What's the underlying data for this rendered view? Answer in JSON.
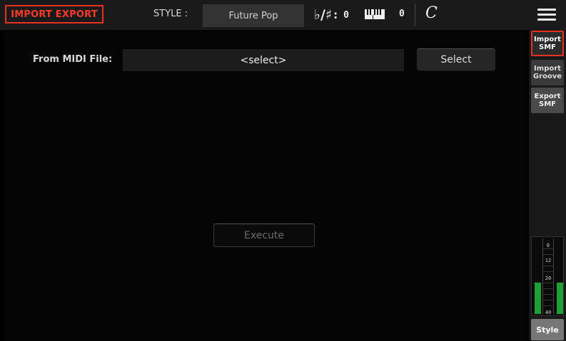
{
  "header": {
    "page_title": "IMPORT EXPORT",
    "style_label": "STYLE :",
    "style_name": "Future Pop",
    "transpose_icon": "flat-sharp-icon",
    "transpose_value": "0",
    "keyboard_icon": "keyboard-icon",
    "octave_value": "0",
    "tempo_icon": "common-time-icon",
    "tempo_symbol": "C",
    "menu_icon": "hamburger-menu-icon"
  },
  "main": {
    "from_midi_label": "From MIDI File:",
    "midi_field_value": "<select>",
    "select_button": "Select",
    "execute_button": "Execute"
  },
  "side_tabs": [
    {
      "line1": "Import",
      "line2": "SMF",
      "selected": true
    },
    {
      "line1": "Import",
      "line2": "Groove",
      "selected": false
    },
    {
      "line1": "Export",
      "line2": "SMF",
      "selected": false
    }
  ],
  "meter": {
    "scale_labels": [
      "0",
      "12",
      "20",
      "40"
    ],
    "left_level": 0.42,
    "right_level": 0.42,
    "bar_color": "#1ea035"
  },
  "style_button": "Style",
  "colors": {
    "accent": "#e8321e",
    "background": "#000000"
  }
}
